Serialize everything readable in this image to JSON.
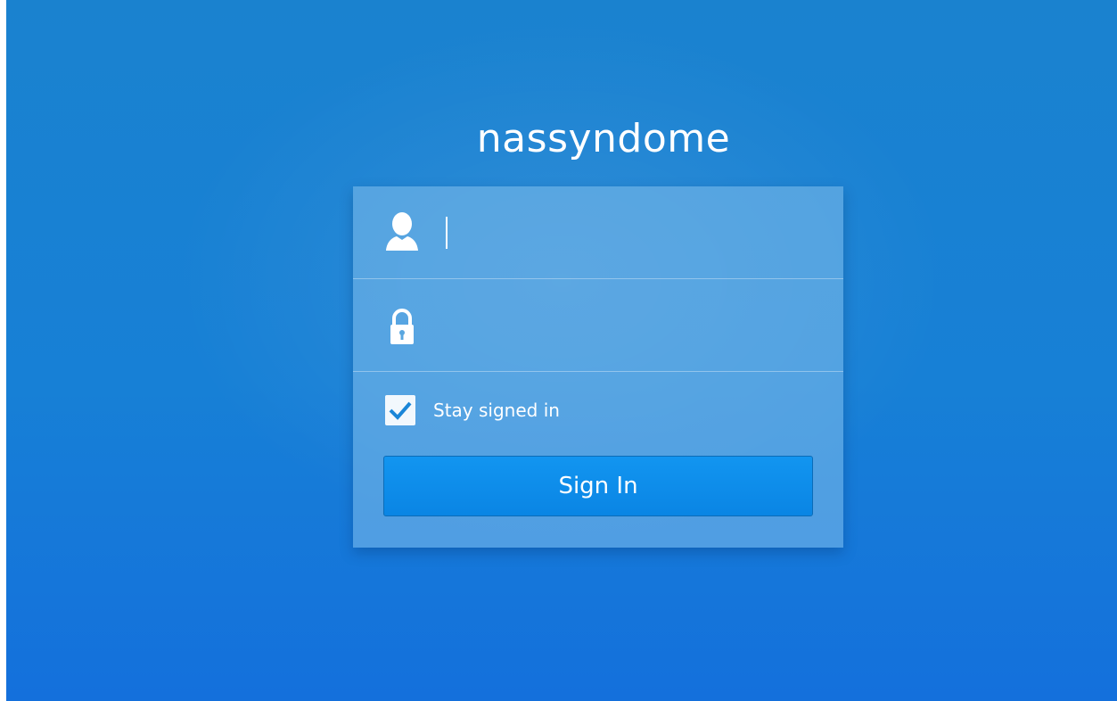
{
  "login": {
    "hostname": "nassyndome",
    "username": {
      "value": "",
      "placeholder": "",
      "icon": "user-icon"
    },
    "password": {
      "value": "",
      "placeholder": "",
      "icon": "lock-icon"
    },
    "stay_signed_in": {
      "label": "Stay signed in",
      "checked": true
    },
    "sign_in_label": "Sign In"
  },
  "colors": {
    "background_top": "#1a82cf",
    "background_bottom": "#1470dc",
    "panel": "#6fb0e4",
    "button": "#0a85e4",
    "text": "#ffffff"
  }
}
